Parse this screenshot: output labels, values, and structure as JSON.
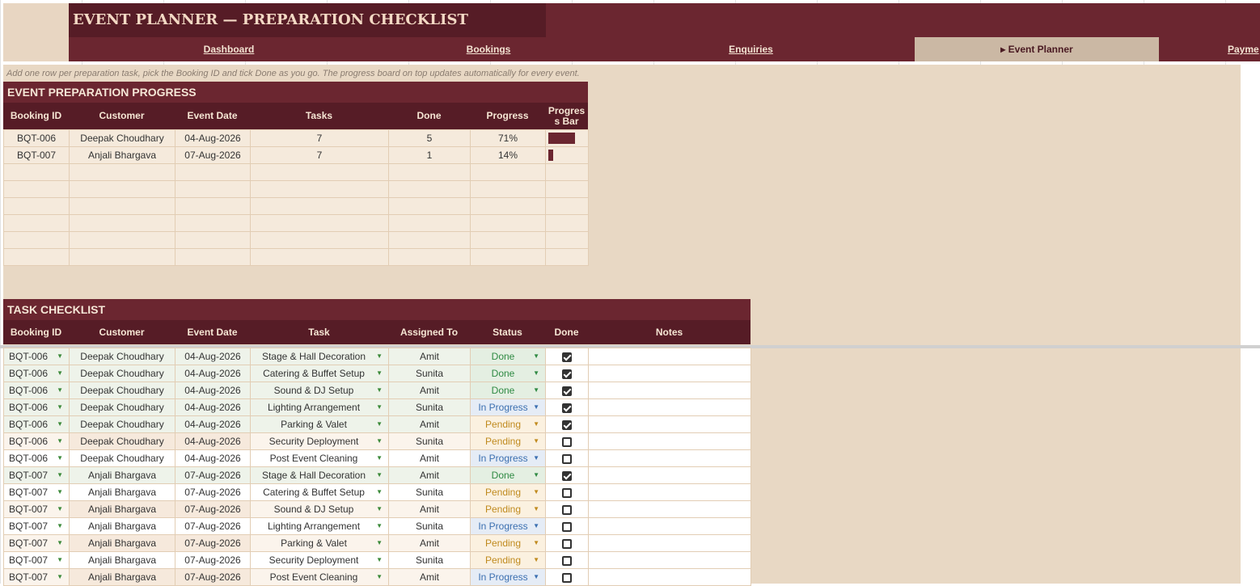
{
  "title": "EVENT PLANNER — PREPARATION CHECKLIST",
  "nav": [
    "Dashboard",
    "Bookings",
    "Enquiries",
    "▸ Event Planner",
    "Payme"
  ],
  "hint": "Add one row per preparation task, pick the Booking ID and tick Done as you go. The progress board on top updates automatically for every event.",
  "progress": {
    "title": "EVENT PREPARATION PROGRESS",
    "headers": [
      "Booking ID",
      "Customer",
      "Event Date",
      "Tasks",
      "Done",
      "Progress",
      "Progres\ns Bar"
    ],
    "rows": [
      {
        "id": "BQT-006",
        "customer": "Deepak Choudhary",
        "date": "04-Aug-2026",
        "tasks": "7",
        "done": "5",
        "progress": "71%",
        "fraction": 0.71
      },
      {
        "id": "BQT-007",
        "customer": "Anjali Bhargava",
        "date": "07-Aug-2026",
        "tasks": "7",
        "done": "1",
        "progress": "14%",
        "fraction": 0.14
      }
    ]
  },
  "checklist": {
    "title": "TASK CHECKLIST",
    "headers": [
      "Booking ID",
      "Customer",
      "Event Date",
      "Task",
      "Assigned To",
      "Status",
      "Done",
      "Notes"
    ],
    "rows": [
      {
        "id": "BQT-006",
        "customer": "Deepak Choudhary",
        "date": "04-Aug-2026",
        "task": "Stage & Hall Decoration",
        "assigned": "Amit",
        "status": "Done",
        "done": true
      },
      {
        "id": "BQT-006",
        "customer": "Deepak Choudhary",
        "date": "04-Aug-2026",
        "task": "Catering & Buffet Setup",
        "assigned": "Sunita",
        "status": "Done",
        "done": true
      },
      {
        "id": "BQT-006",
        "customer": "Deepak Choudhary",
        "date": "04-Aug-2026",
        "task": "Sound & DJ Setup",
        "assigned": "Amit",
        "status": "Done",
        "done": true
      },
      {
        "id": "BQT-006",
        "customer": "Deepak Choudhary",
        "date": "04-Aug-2026",
        "task": "Lighting Arrangement",
        "assigned": "Sunita",
        "status": "In Progress",
        "done": true
      },
      {
        "id": "BQT-006",
        "customer": "Deepak Choudhary",
        "date": "04-Aug-2026",
        "task": "Parking & Valet",
        "assigned": "Amit",
        "status": "Pending",
        "done": true
      },
      {
        "id": "BQT-006",
        "customer": "Deepak Choudhary",
        "date": "04-Aug-2026",
        "task": "Security Deployment",
        "assigned": "Sunita",
        "status": "Pending",
        "done": false
      },
      {
        "id": "BQT-006",
        "customer": "Deepak Choudhary",
        "date": "04-Aug-2026",
        "task": "Post Event Cleaning",
        "assigned": "Amit",
        "status": "In Progress",
        "done": false
      },
      {
        "id": "BQT-007",
        "customer": "Anjali Bhargava",
        "date": "07-Aug-2026",
        "task": "Stage & Hall Decoration",
        "assigned": "Amit",
        "status": "Done",
        "done": true
      },
      {
        "id": "BQT-007",
        "customer": "Anjali Bhargava",
        "date": "07-Aug-2026",
        "task": "Catering & Buffet Setup",
        "assigned": "Sunita",
        "status": "Pending",
        "done": false
      },
      {
        "id": "BQT-007",
        "customer": "Anjali Bhargava",
        "date": "07-Aug-2026",
        "task": "Sound & DJ Setup",
        "assigned": "Amit",
        "status": "Pending",
        "done": false
      },
      {
        "id": "BQT-007",
        "customer": "Anjali Bhargava",
        "date": "07-Aug-2026",
        "task": "Lighting Arrangement",
        "assigned": "Sunita",
        "status": "In Progress",
        "done": false
      },
      {
        "id": "BQT-007",
        "customer": "Anjali Bhargava",
        "date": "07-Aug-2026",
        "task": "Parking & Valet",
        "assigned": "Amit",
        "status": "Pending",
        "done": false
      },
      {
        "id": "BQT-007",
        "customer": "Anjali Bhargava",
        "date": "07-Aug-2026",
        "task": "Security Deployment",
        "assigned": "Sunita",
        "status": "Pending",
        "done": false
      },
      {
        "id": "BQT-007",
        "customer": "Anjali Bhargava",
        "date": "07-Aug-2026",
        "task": "Post Event Cleaning",
        "assigned": "Amit",
        "status": "In Progress",
        "done": false
      }
    ]
  },
  "colors": {
    "accent": "#6b2630",
    "header": "#561c26",
    "background": "#e8d8c4"
  }
}
